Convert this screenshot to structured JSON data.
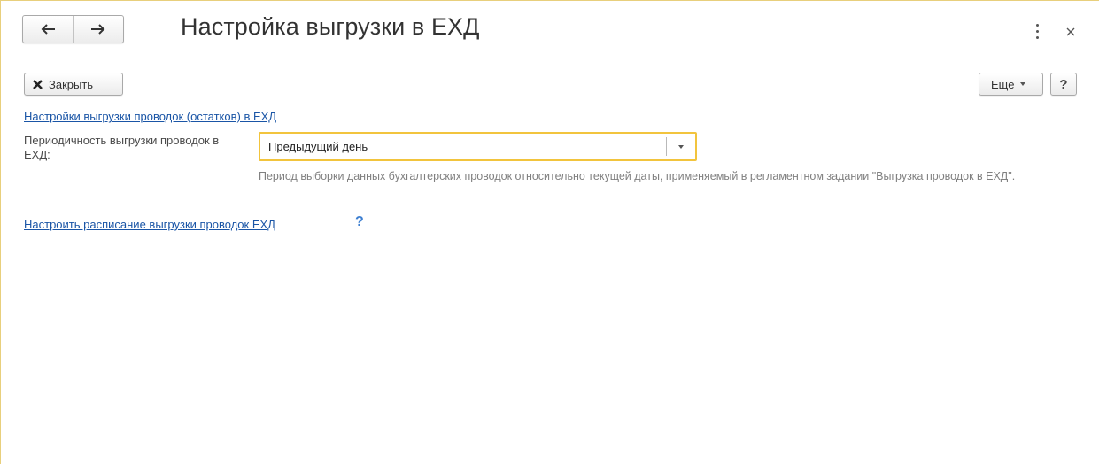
{
  "window": {
    "title": "Настройка выгрузки в ЕХД"
  },
  "toolbar": {
    "close_label": "Закрыть",
    "more_label": "Еще",
    "help_label": "?"
  },
  "main": {
    "settings_link": "Настройки выгрузки проводок (остатков) в ЕХД",
    "periodicity": {
      "label": "Периодичность выгрузки проводок в ЕХД:",
      "value": "Предыдущий день",
      "hint": "Период выборки данных бухгалтерских проводок относительно текущей даты, применяемый в регламентном задании \"Выгрузка проводок в  ЕХД\"."
    },
    "schedule_link": "Настроить расписание выгрузки проводок ЕХД",
    "schedule_help": "?"
  },
  "colors": {
    "accent_border": "#f2c43d",
    "window_border": "#e8cf7c",
    "link": "#1a55a6",
    "help_icon": "#3d7fd1"
  },
  "icons": [
    "arrow-left-icon",
    "arrow-right-icon",
    "kebab-menu-icon",
    "close-icon",
    "close-x-icon",
    "chevron-down-icon"
  ]
}
